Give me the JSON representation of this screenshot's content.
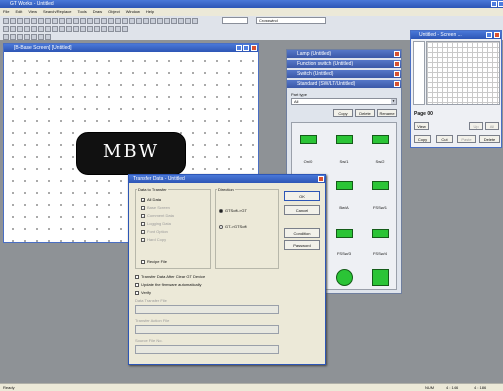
{
  "app": {
    "title": "GT Works - Untitled"
  },
  "menubar": {
    "items": [
      "File",
      "Edit",
      "View",
      "Search/Replace",
      "Tools",
      "Draw",
      "Object",
      "Window",
      "Help"
    ]
  },
  "toolbar": {
    "combo_value": "Crosswind"
  },
  "screen_window": {
    "title": "[B-Base Screen] [Untitled]"
  },
  "canvas": {
    "object_label": "MBW"
  },
  "panels": {
    "lamp_title": "Lamp (Untitled)",
    "function_switch_title": "Function switch (Untitled)",
    "switch_title": "Switch (Untitled)",
    "standard_title": "Standard (SW/LT/Untitled)",
    "part_type_label": "Part type",
    "part_type_value": "All",
    "btn_copy": "Copy",
    "btn_delete": "Delete",
    "btn_rename": "Rename",
    "parts": [
      "On/0",
      "Sw/1",
      "Sw/2",
      "Bw/A",
      "Bw/A",
      "FSSw/1",
      "FSSw/3",
      "FSSw/4"
    ]
  },
  "preview_window": {
    "title": "Untitled - Screen ...",
    "page_label": "Page 00",
    "btn_view": "View",
    "btn_copy": "Copy",
    "btn_cut": "Cut",
    "btn_paste": "Paste",
    "btn_delete": "Delete",
    "btn_up": "Up",
    "btn_all": "All"
  },
  "dialog": {
    "title": "Transfer Data - Untitled",
    "data_group_label": "Data to Transfer",
    "options": [
      {
        "label": "All Data",
        "checked": true,
        "enabled": true
      },
      {
        "label": "Base Screen",
        "checked": true,
        "enabled": false
      },
      {
        "label": "Comment Data",
        "checked": true,
        "enabled": false
      },
      {
        "label": "Logging Data",
        "checked": true,
        "enabled": false
      },
      {
        "label": "Font Option",
        "checked": true,
        "enabled": false
      },
      {
        "label": "Hard Copy",
        "checked": true,
        "enabled": false
      }
    ],
    "recipe_file": "Recipe File",
    "direction_label": "Direction",
    "dir_pc_gt": "GTSoft->GT",
    "dir_gt_pc": "GT->GTSoft",
    "btn_ok": "OK",
    "btn_cancel": "Cancel",
    "btn_condition": "Condition",
    "btn_password": "Password",
    "check_clear": "Transfer Data After Clear GT Device",
    "check_update": "Update the firmware automatically",
    "check_verify": "Verify",
    "field1_label": "Data Transfer File",
    "field2_label": "Transfer Action File",
    "field3_label": "Source File No."
  },
  "statusbar": {
    "left": "Ready",
    "cells": [
      "NUM",
      "4 : 146",
      "4 : 186"
    ]
  }
}
